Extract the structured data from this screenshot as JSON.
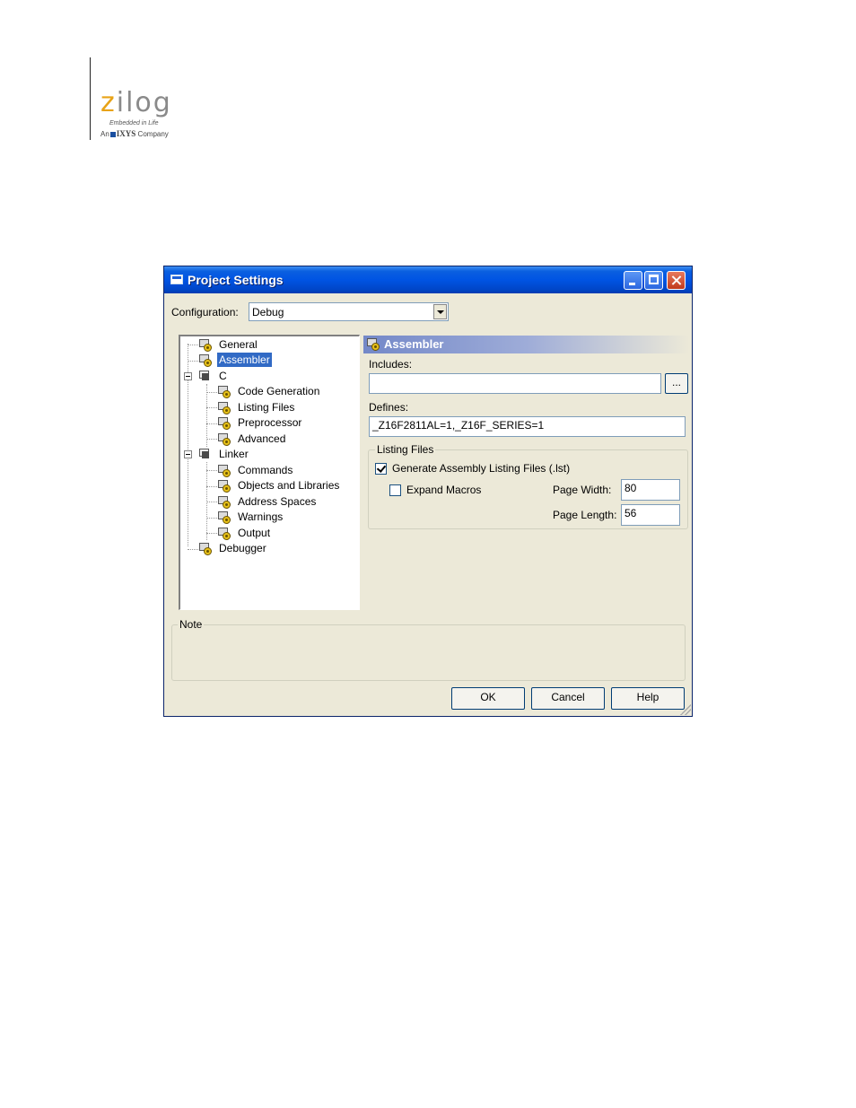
{
  "logo": {
    "wordmark_z": "z",
    "wordmark_rest": "ilog",
    "tagline": "Embedded in Life",
    "company_prefix": "An",
    "company_brand": "IXYS",
    "company_suffix": "Company"
  },
  "window": {
    "title": "Project Settings",
    "icon": "window-app-icon"
  },
  "configuration": {
    "label": "Configuration:",
    "value": "Debug"
  },
  "tree": {
    "items": [
      {
        "label": "General",
        "icon": "gear-doc-icon"
      },
      {
        "label": "Assembler",
        "icon": "gear-doc-icon",
        "selected": true
      },
      {
        "label": "C",
        "icon": "folder-gear-icon",
        "expanded": true
      },
      {
        "label": "Code Generation",
        "icon": "gear-doc-icon"
      },
      {
        "label": "Listing Files",
        "icon": "gear-doc-icon"
      },
      {
        "label": "Preprocessor",
        "icon": "gear-doc-icon"
      },
      {
        "label": "Advanced",
        "icon": "gear-doc-icon"
      },
      {
        "label": "Linker",
        "icon": "folder-gear-icon",
        "expanded": true
      },
      {
        "label": "Commands",
        "icon": "gear-doc-icon"
      },
      {
        "label": "Objects and Libraries",
        "icon": "gear-doc-icon"
      },
      {
        "label": "Address Spaces",
        "icon": "gear-doc-icon"
      },
      {
        "label": "Warnings",
        "icon": "gear-doc-icon"
      },
      {
        "label": "Output",
        "icon": "gear-doc-icon"
      },
      {
        "label": "Debugger",
        "icon": "gear-doc-icon"
      }
    ]
  },
  "panel": {
    "title": "Assembler",
    "includes_label": "Includes:",
    "includes_value": "",
    "browse_label": "...",
    "defines_label": "Defines:",
    "defines_value": "_Z16F2811AL=1,_Z16F_SERIES=1",
    "listing_group": "Listing Files",
    "generate_listing_label": "Generate Assembly Listing Files (.lst)",
    "generate_listing_checked": true,
    "expand_macros_label": "Expand Macros",
    "expand_macros_checked": false,
    "page_width_label": "Page Width:",
    "page_width_value": "80",
    "page_length_label": "Page Length:",
    "page_length_value": "56"
  },
  "note": {
    "label": "Note",
    "text": ""
  },
  "buttons": {
    "ok": "OK",
    "cancel": "Cancel",
    "help": "Help"
  },
  "colors": {
    "titlebar": "#0054e3",
    "selection": "#316ac5",
    "dialog_bg": "#ece9d8",
    "logo_accent": "#e8a317"
  }
}
